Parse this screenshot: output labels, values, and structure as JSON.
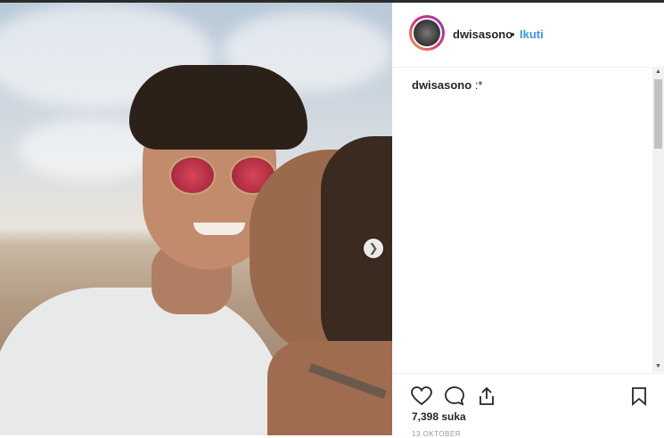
{
  "post": {
    "username": "dwisasono",
    "separator": "•",
    "follow_label": "Ikuti",
    "caption_user": "dwisasono",
    "caption_text": ":*",
    "likes_label": "7,398 suka",
    "date_label": "13 OKTOBER"
  },
  "icons": {
    "next": "chevron-right-icon",
    "like": "heart-icon",
    "comment": "comment-icon",
    "share": "share-icon",
    "save": "bookmark-icon"
  },
  "colors": {
    "link_blue": "#3897f0",
    "text_dark": "#262626"
  }
}
